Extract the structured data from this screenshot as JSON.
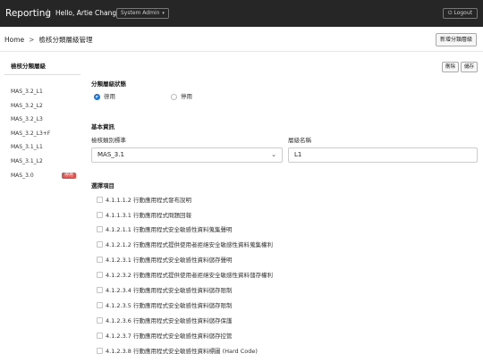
{
  "topbar": {
    "brand": "Reporting",
    "greeting": "Hello, Artie Chang",
    "role": "System Admin",
    "logout": "Logout"
  },
  "breadcrumb": {
    "home": "Home",
    "current": "檢核分類層級管理"
  },
  "header": {
    "add_button": "新增分類層級"
  },
  "sidebar": {
    "title": "檢核分類層級",
    "items": [
      "MAS_3.2_L1",
      "MAS_3.2_L2",
      "MAS_3.2_L3",
      "MAS_3.2_L3+F",
      "MAS_3.1_L1",
      "MAS_3.1_L2",
      "MAS_3.0"
    ],
    "badge": "停用"
  },
  "actions": {
    "delete": "刪除",
    "save": "儲存"
  },
  "status": {
    "title": "分類層級狀態",
    "enabled": "啓用",
    "disabled": "停用",
    "selected": "enabled"
  },
  "basic": {
    "title": "基本資訊",
    "standard_label": "檢核類別標準",
    "standard_value": "MAS_3.1",
    "level_label": "層級名稱",
    "level_value": "L1"
  },
  "selection": {
    "title": "選擇項目",
    "items": [
      "4.1.1.1.2 行動應用程式發布說明",
      "4.1.1.3.1 行動應用程式問題回報",
      "4.1.2.1.1 行動應用程式安全敏感性資料蒐集聲明",
      "4.1.2.1.2 行動應用程式提供使用者拒絕安全敏感性資料蒐集權利",
      "4.1.2.3.1 行動應用程式安全敏感性資料儲存聲明",
      "4.1.2.3.2 行動應用程式提供使用者拒絕安全敏感性資料儲存權利",
      "4.1.2.3.4 行動應用程式安全敏感性資料儲存限制",
      "4.1.2.3.5 行動應用程式安全敏感性資料儲存限制",
      "4.1.2.3.6 行動應用程式安全敏感性資料儲存保護",
      "4.1.2.3.7 行動應用程式安全敏感性資料儲存控管",
      "4.1.2.3.8 行動應用程式安全敏感性資料標圖 (Hard Code)"
    ]
  }
}
